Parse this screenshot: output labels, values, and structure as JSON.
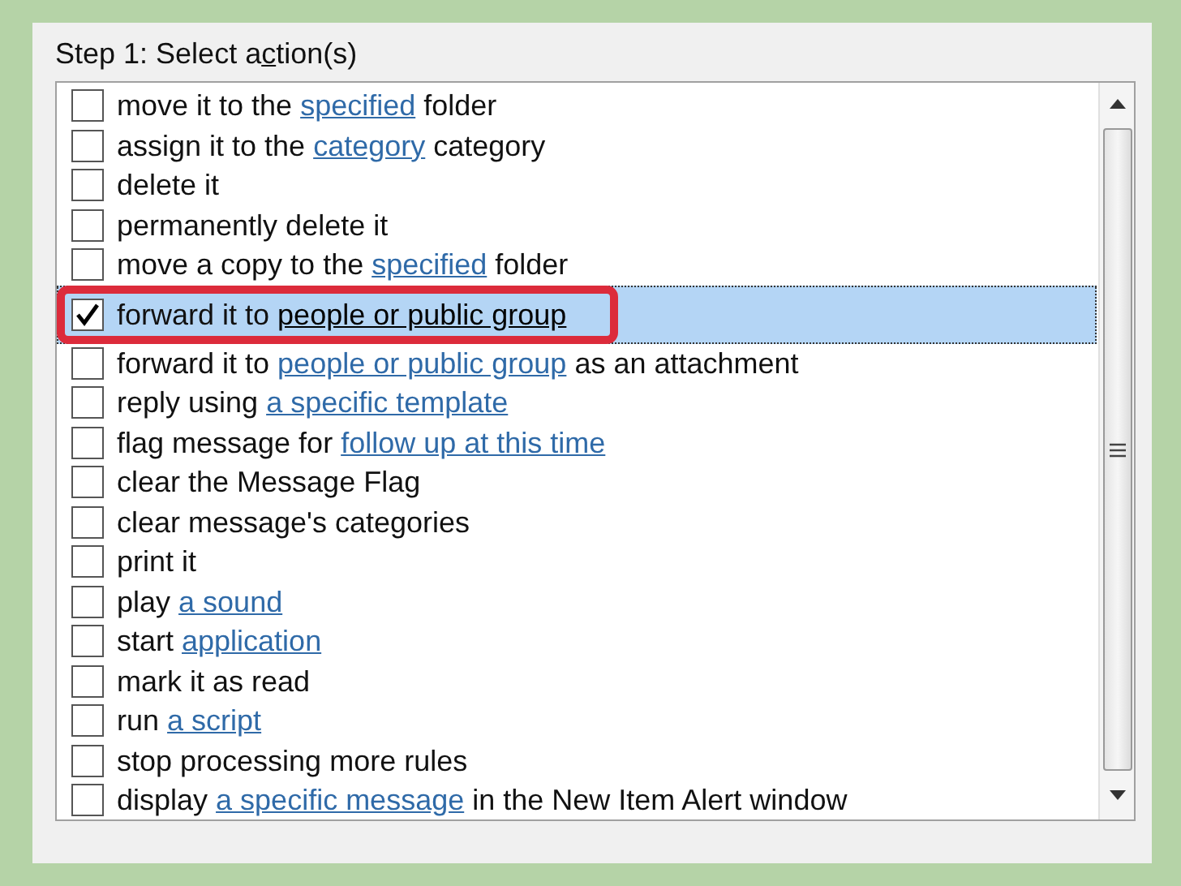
{
  "title": {
    "before": "Step 1: Select a",
    "access_key": "c",
    "after": "tion(s)"
  },
  "actions": [
    {
      "checked": false,
      "selected": false,
      "segments": [
        {
          "kind": "plain",
          "text": "move it to the "
        },
        {
          "kind": "link",
          "text": "specified"
        },
        {
          "kind": "plain",
          "text": " folder"
        }
      ]
    },
    {
      "checked": false,
      "selected": false,
      "segments": [
        {
          "kind": "plain",
          "text": "assign it to the "
        },
        {
          "kind": "link",
          "text": "category"
        },
        {
          "kind": "plain",
          "text": " category"
        }
      ]
    },
    {
      "checked": false,
      "selected": false,
      "segments": [
        {
          "kind": "plain",
          "text": "delete it"
        }
      ]
    },
    {
      "checked": false,
      "selected": false,
      "segments": [
        {
          "kind": "plain",
          "text": "permanently delete it"
        }
      ]
    },
    {
      "checked": false,
      "selected": false,
      "segments": [
        {
          "kind": "plain",
          "text": "move a copy to the "
        },
        {
          "kind": "link",
          "text": "specified"
        },
        {
          "kind": "plain",
          "text": " folder"
        }
      ]
    },
    {
      "checked": true,
      "selected": true,
      "highlighted": true,
      "segments": [
        {
          "kind": "plain",
          "text": "forward it to "
        },
        {
          "kind": "link",
          "text": "people or public group"
        }
      ]
    },
    {
      "checked": false,
      "selected": false,
      "segments": [
        {
          "kind": "plain",
          "text": "forward it to "
        },
        {
          "kind": "link",
          "text": "people or public group"
        },
        {
          "kind": "plain",
          "text": " as an attachment"
        }
      ]
    },
    {
      "checked": false,
      "selected": false,
      "segments": [
        {
          "kind": "plain",
          "text": "reply using "
        },
        {
          "kind": "link",
          "text": "a specific template"
        }
      ]
    },
    {
      "checked": false,
      "selected": false,
      "segments": [
        {
          "kind": "plain",
          "text": "flag message for "
        },
        {
          "kind": "link",
          "text": "follow up at this time"
        }
      ]
    },
    {
      "checked": false,
      "selected": false,
      "segments": [
        {
          "kind": "plain",
          "text": "clear the Message Flag"
        }
      ]
    },
    {
      "checked": false,
      "selected": false,
      "segments": [
        {
          "kind": "plain",
          "text": "clear message's categories"
        }
      ]
    },
    {
      "checked": false,
      "selected": false,
      "segments": [
        {
          "kind": "plain",
          "text": "print it"
        }
      ]
    },
    {
      "checked": false,
      "selected": false,
      "segments": [
        {
          "kind": "plain",
          "text": "play "
        },
        {
          "kind": "link",
          "text": "a sound"
        }
      ]
    },
    {
      "checked": false,
      "selected": false,
      "segments": [
        {
          "kind": "plain",
          "text": "start "
        },
        {
          "kind": "link",
          "text": "application"
        }
      ]
    },
    {
      "checked": false,
      "selected": false,
      "segments": [
        {
          "kind": "plain",
          "text": "mark it as read"
        }
      ]
    },
    {
      "checked": false,
      "selected": false,
      "segments": [
        {
          "kind": "plain",
          "text": "run "
        },
        {
          "kind": "link",
          "text": "a script"
        }
      ]
    },
    {
      "checked": false,
      "selected": false,
      "segments": [
        {
          "kind": "plain",
          "text": "stop processing more rules"
        }
      ]
    },
    {
      "checked": false,
      "selected": false,
      "segments": [
        {
          "kind": "plain",
          "text": "display "
        },
        {
          "kind": "link",
          "text": "a specific message"
        },
        {
          "kind": "plain",
          "text": " in the New Item Alert window"
        }
      ]
    }
  ]
}
